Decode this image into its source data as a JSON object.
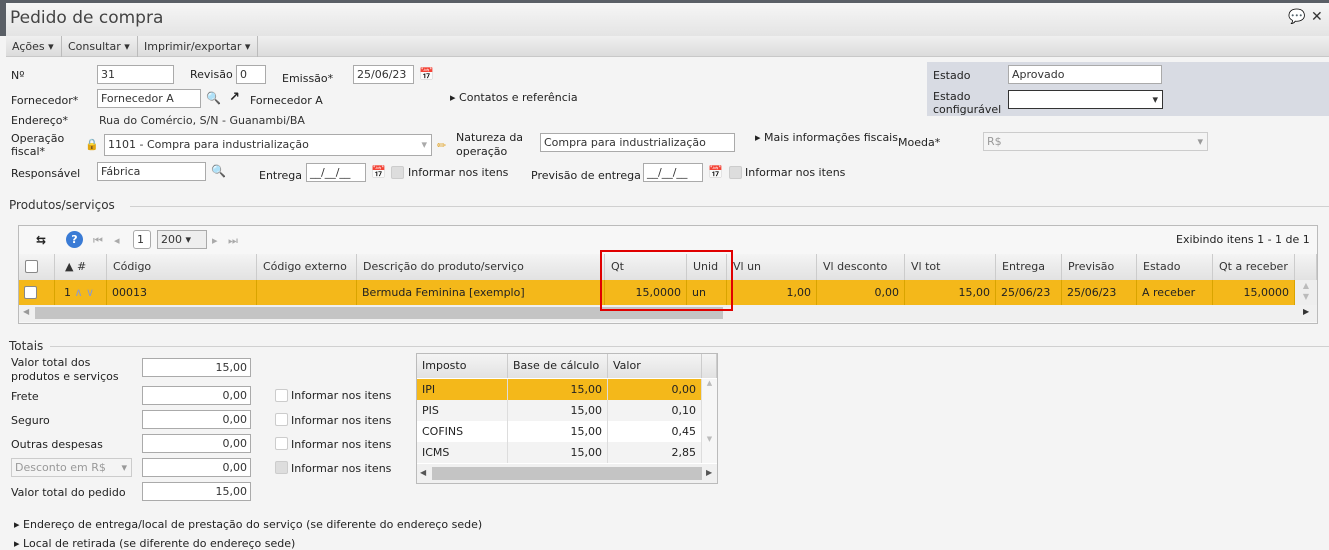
{
  "window": {
    "title": "Pedido de compra"
  },
  "menu": [
    "Ações",
    "Consultar",
    "Imprimir/exportar"
  ],
  "form": {
    "numero_label": "Nº",
    "numero": "31",
    "revisao_label": "Revisão",
    "revisao": "0",
    "emissao_label": "Emissão*",
    "emissao": "25/06/23",
    "fornecedor_label": "Fornecedor*",
    "fornecedor": "Fornecedor A",
    "fornecedor_link": "Fornecedor A",
    "contatos": "Contatos e referência",
    "endereco_label": "Endereço*",
    "endereco": "Rua do Comércio, S/N - Guanambi/BA",
    "operacao_label1": "Operação",
    "operacao_label2": "fiscal*",
    "operacao": "1101 - Compra para industrialização",
    "natureza_label1": "Natureza da",
    "natureza_label2": "operação",
    "natureza": "Compra para industrialização",
    "mais_info": "Mais informações fiscais",
    "moeda_label": "Moeda*",
    "moeda": "R$",
    "responsavel_label": "Responsável",
    "responsavel": "Fábrica",
    "entrega_label": "Entrega",
    "entrega": "__/__/__",
    "informar": "Informar nos itens",
    "previsao_label": "Previsão de entrega",
    "previsao": "__/__/__",
    "estado_label": "Estado",
    "estado": "Aprovado",
    "estado_conf_label1": "Estado",
    "estado_conf_label2": "configurável",
    "estado_conf": ""
  },
  "produtos": {
    "section": "Produtos/serviços",
    "page": "1",
    "page_size": "200",
    "exibindo": "Exibindo itens 1 - 1 de 1",
    "columns": [
      "▲ #",
      "Código",
      "Código externo",
      "Descrição do produto/serviço",
      "Qt",
      "Unid",
      "Vl un",
      "Vl desconto",
      "Vl tot",
      "Entrega",
      "Previsão",
      "Estado",
      "Qt a receber"
    ],
    "rows": [
      {
        "n": "1",
        "codigo": "00013",
        "externo": "",
        "descricao": "Bermuda Feminina [exemplo]",
        "qt": "15,0000",
        "unid": "un",
        "vlun": "1,00",
        "desc": "0,00",
        "tot": "15,00",
        "entrega": "25/06/23",
        "previsao": "25/06/23",
        "estado": "A receber",
        "qtrec": "15,0000"
      }
    ]
  },
  "totais": {
    "section": "Totais",
    "valor_prod_label1": "Valor total dos",
    "valor_prod_label2": "produtos e serviços",
    "valor_prod": "15,00",
    "frete_label": "Frete",
    "frete": "0,00",
    "seguro_label": "Seguro",
    "seguro": "0,00",
    "outras_label": "Outras despesas",
    "outras": "0,00",
    "desconto_select": "Desconto em R$",
    "desconto": "0,00",
    "valor_pedido_label": "Valor total do pedido",
    "valor_pedido": "15,00",
    "informar": "Informar nos itens"
  },
  "impostos": {
    "columns": [
      "Imposto",
      "Base de cálculo",
      "Valor"
    ],
    "rows": [
      {
        "n": "IPI",
        "base": "15,00",
        "v": "0,00"
      },
      {
        "n": "PIS",
        "base": "15,00",
        "v": "0,10"
      },
      {
        "n": "COFINS",
        "base": "15,00",
        "v": "0,45"
      },
      {
        "n": "ICMS",
        "base": "15,00",
        "v": "2,85"
      }
    ]
  },
  "footer": [
    "Endereço de entrega/local de prestação do serviço (se diferente do endereço sede)",
    "Local de retirada (se diferente do endereço sede)"
  ]
}
